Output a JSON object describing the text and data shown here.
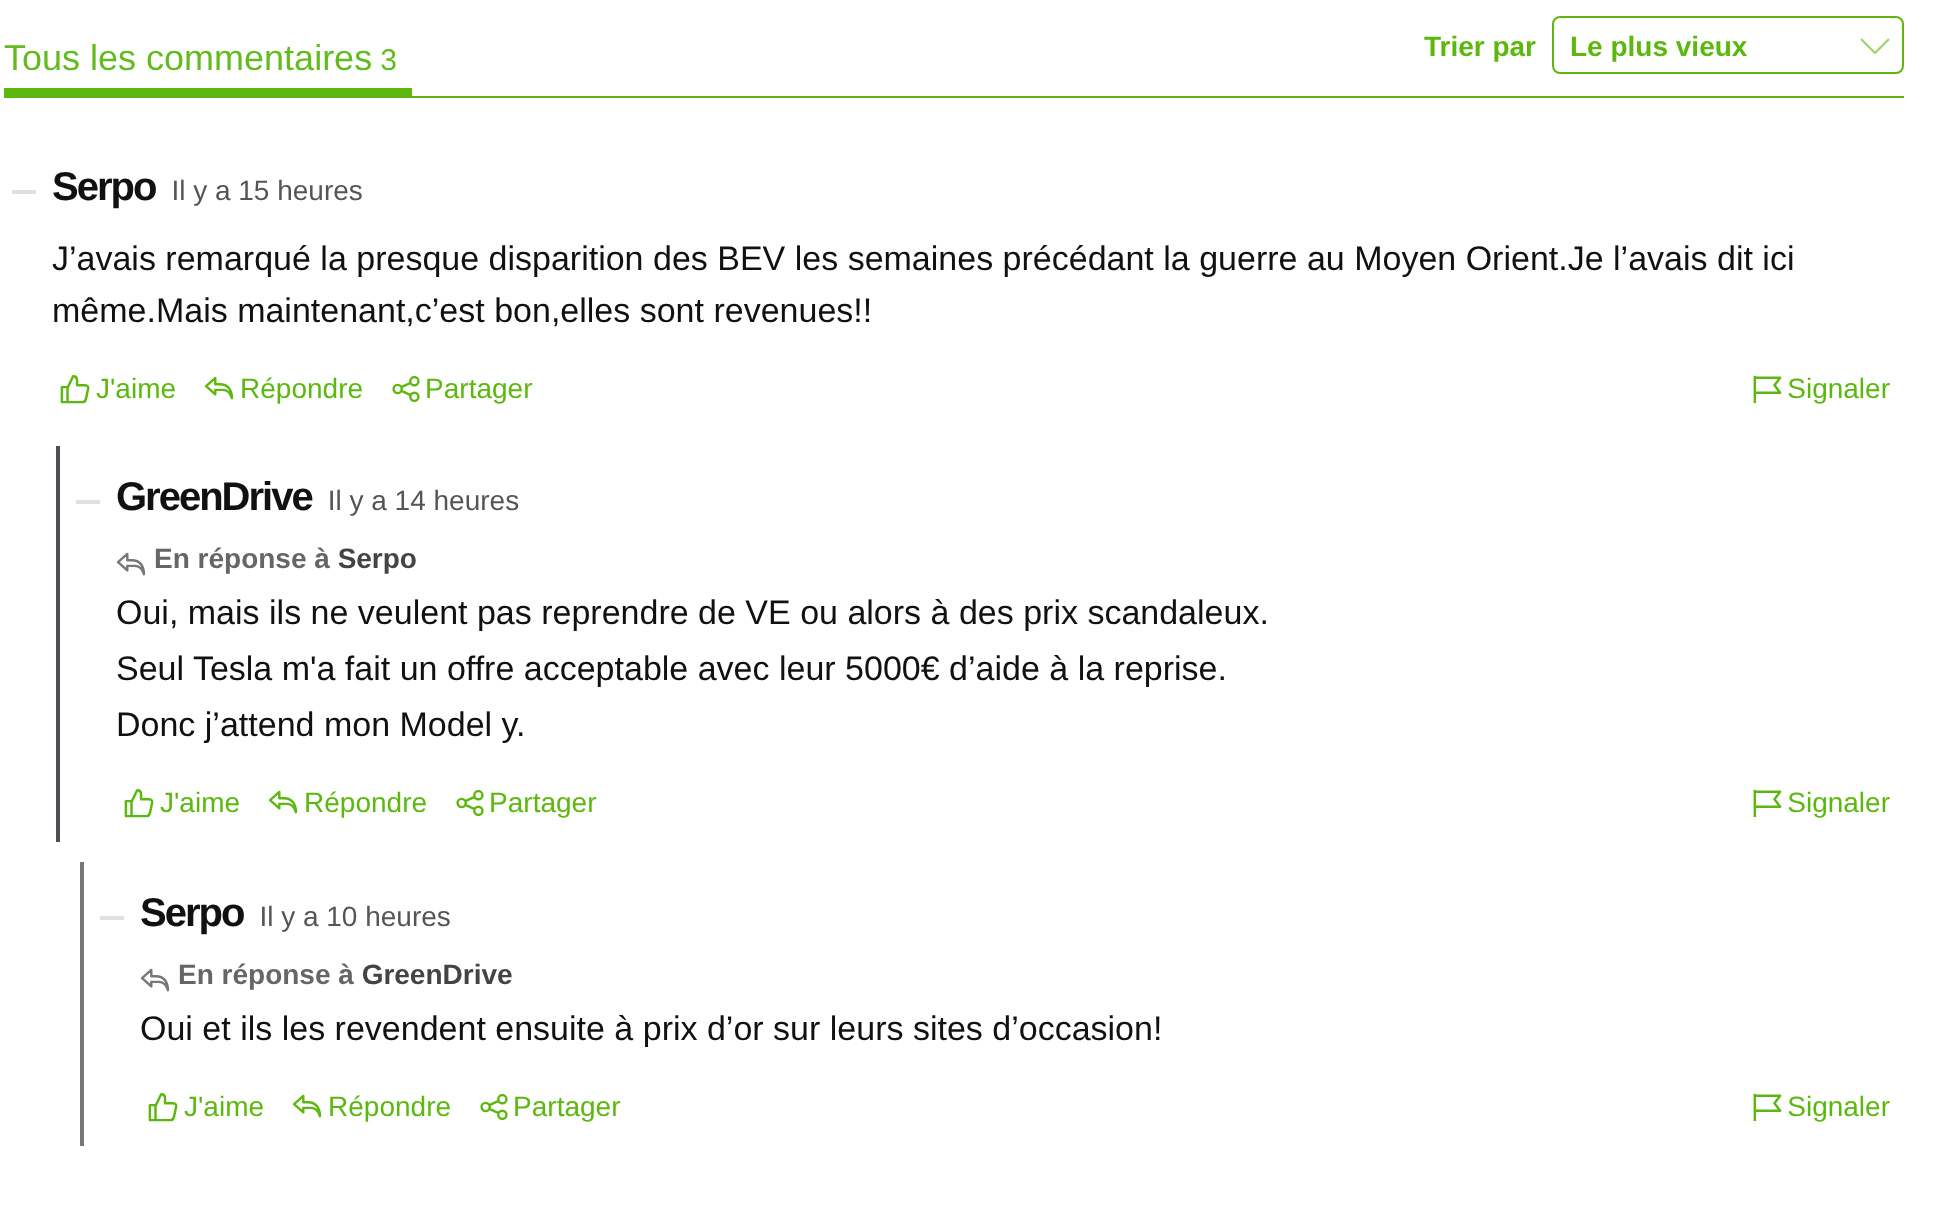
{
  "header": {
    "tab": {
      "label": "Tous les commentaires",
      "count": "3",
      "selected": true
    },
    "sort": {
      "label": "Trier par",
      "value": "Le plus vieux"
    }
  },
  "comments": [
    {
      "author": "Serpo",
      "time": "Il y a 15 heures",
      "text": [
        "J’avais remarqué la presque disparition des BEV les semaines précédant la guerre au Moyen Orient.Je l’avais dit ici même.Mais maintenant,c’est bon,elles sont revenues!!"
      ],
      "actions": [
        {
          "kind": "like",
          "label": "J'aime"
        },
        {
          "kind": "reply",
          "label": "Répondre"
        },
        {
          "kind": "share",
          "label": "Partager"
        },
        {
          "kind": "report",
          "label": "Signaler"
        }
      ],
      "children": [
        {
          "author": "GreenDrive",
          "time": "Il y a 14 heures",
          "in_reply_to": {
            "label": "En réponse à",
            "author": "Serpo"
          },
          "text": [
            "Oui, mais ils ne veulent pas reprendre de VE ou alors à des prix scandaleux.",
            "Seul Tesla m'a fait un offre acceptable avec leur 5000€ d’aide à la reprise.",
            "Donc j’attend mon Model y."
          ],
          "actions": [
            {
              "kind": "like",
              "label": "J'aime"
            },
            {
              "kind": "reply",
              "label": "Répondre"
            },
            {
              "kind": "share",
              "label": "Partager"
            },
            {
              "kind": "report",
              "label": "Signaler"
            }
          ],
          "children": [
            {
              "author": "Serpo",
              "time": "Il y a 10 heures",
              "in_reply_to": {
                "label": "En réponse à",
                "author": "GreenDrive"
              },
              "text": [
                "Oui et ils les revendent ensuite à prix d’or sur leurs sites d’occasion!"
              ],
              "actions": [
                {
                  "kind": "like",
                  "label": "J'aime"
                },
                {
                  "kind": "reply",
                  "label": "Répondre"
                },
                {
                  "kind": "share",
                  "label": "Partager"
                },
                {
                  "kind": "report",
                  "label": "Signaler"
                }
              ]
            }
          ]
        }
      ]
    }
  ]
}
